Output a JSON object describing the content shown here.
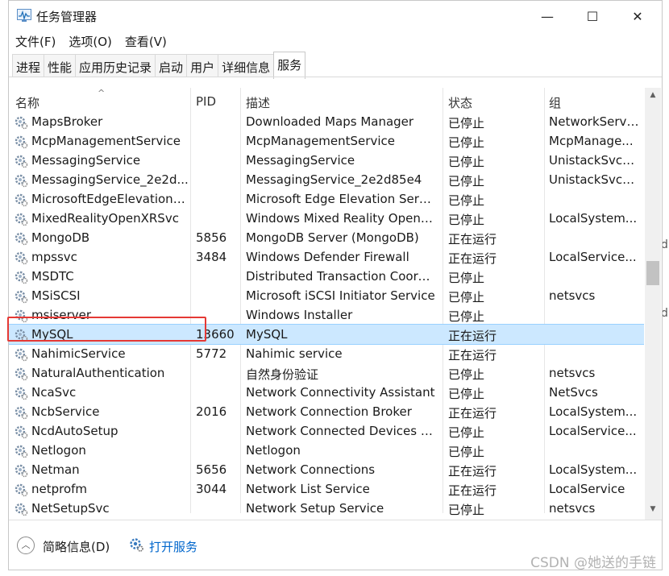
{
  "window": {
    "title": "任务管理器",
    "minimize": "—",
    "maximize": "☐",
    "close": "✕"
  },
  "menu": [
    "文件(F)",
    "选项(O)",
    "查看(V)"
  ],
  "tabs": [
    "进程",
    "性能",
    "应用历史记录",
    "启动",
    "用户",
    "详细信息",
    "服务"
  ],
  "active_tab": "服务",
  "columns": {
    "name": "名称",
    "pid": "PID",
    "description": "描述",
    "status": "状态",
    "group": "组"
  },
  "rows": [
    {
      "name": "MapsBroker",
      "pid": "",
      "description": "Downloaded Maps Manager",
      "status": "已停止",
      "group": "NetworkServi..."
    },
    {
      "name": "McpManagementService",
      "pid": "",
      "description": "McpManagementService",
      "status": "已停止",
      "group": "McpManage..."
    },
    {
      "name": "MessagingService",
      "pid": "",
      "description": "MessagingService",
      "status": "已停止",
      "group": "UnistackSvcG..."
    },
    {
      "name": "MessagingService_2e2d...",
      "pid": "",
      "description": "MessagingService_2e2d85e4",
      "status": "已停止",
      "group": "UnistackSvcG..."
    },
    {
      "name": "MicrosoftEdgeElevationS...",
      "pid": "",
      "description": "Microsoft Edge Elevation Servi...",
      "status": "已停止",
      "group": ""
    },
    {
      "name": "MixedRealityOpenXRSvc",
      "pid": "",
      "description": "Windows Mixed Reality OpenX...",
      "status": "已停止",
      "group": "LocalSystem..."
    },
    {
      "name": "MongoDB",
      "pid": "5856",
      "description": "MongoDB Server (MongoDB)",
      "status": "正在运行",
      "group": ""
    },
    {
      "name": "mpssvc",
      "pid": "3484",
      "description": "Windows Defender Firewall",
      "status": "正在运行",
      "group": "LocalService..."
    },
    {
      "name": "MSDTC",
      "pid": "",
      "description": "Distributed Transaction Coordi...",
      "status": "已停止",
      "group": ""
    },
    {
      "name": "MSiSCSI",
      "pid": "",
      "description": "Microsoft iSCSI Initiator Service",
      "status": "已停止",
      "group": "netsvcs"
    },
    {
      "name": "msiserver",
      "pid": "",
      "description": "Windows Installer",
      "status": "已停止",
      "group": ""
    },
    {
      "name": "MySQL",
      "pid": "13660",
      "description": "MySQL",
      "status": "正在运行",
      "group": "",
      "selected": true
    },
    {
      "name": "NahimicService",
      "pid": "5772",
      "description": "Nahimic service",
      "status": "正在运行",
      "group": ""
    },
    {
      "name": "NaturalAuthentication",
      "pid": "",
      "description": "自然身份验证",
      "status": "已停止",
      "group": "netsvcs"
    },
    {
      "name": "NcaSvc",
      "pid": "",
      "description": "Network Connectivity Assistant",
      "status": "已停止",
      "group": "NetSvcs"
    },
    {
      "name": "NcbService",
      "pid": "2016",
      "description": "Network Connection Broker",
      "status": "正在运行",
      "group": "LocalSystem..."
    },
    {
      "name": "NcdAutoSetup",
      "pid": "",
      "description": "Network Connected Devices A...",
      "status": "已停止",
      "group": "LocalService..."
    },
    {
      "name": "Netlogon",
      "pid": "",
      "description": "Netlogon",
      "status": "已停止",
      "group": ""
    },
    {
      "name": "Netman",
      "pid": "5656",
      "description": "Network Connections",
      "status": "正在运行",
      "group": "LocalSystem..."
    },
    {
      "name": "netprofm",
      "pid": "3044",
      "description": "Network List Service",
      "status": "正在运行",
      "group": "LocalService"
    },
    {
      "name": "NetSetupSvc",
      "pid": "",
      "description": "Network Setup Service",
      "status": "已停止",
      "group": "netsvcs"
    }
  ],
  "footer": {
    "brief_label": "简略信息(D)",
    "open_services_label": "打开服务"
  },
  "watermark": "CSDN @她送的手链",
  "colors": {
    "selection": "#cce8ff",
    "highlight_box": "#e53935",
    "link": "#0066cc"
  },
  "icons": {
    "service": "gear-icon",
    "app": "task-manager-icon",
    "collapse": "chevron-up-icon"
  }
}
